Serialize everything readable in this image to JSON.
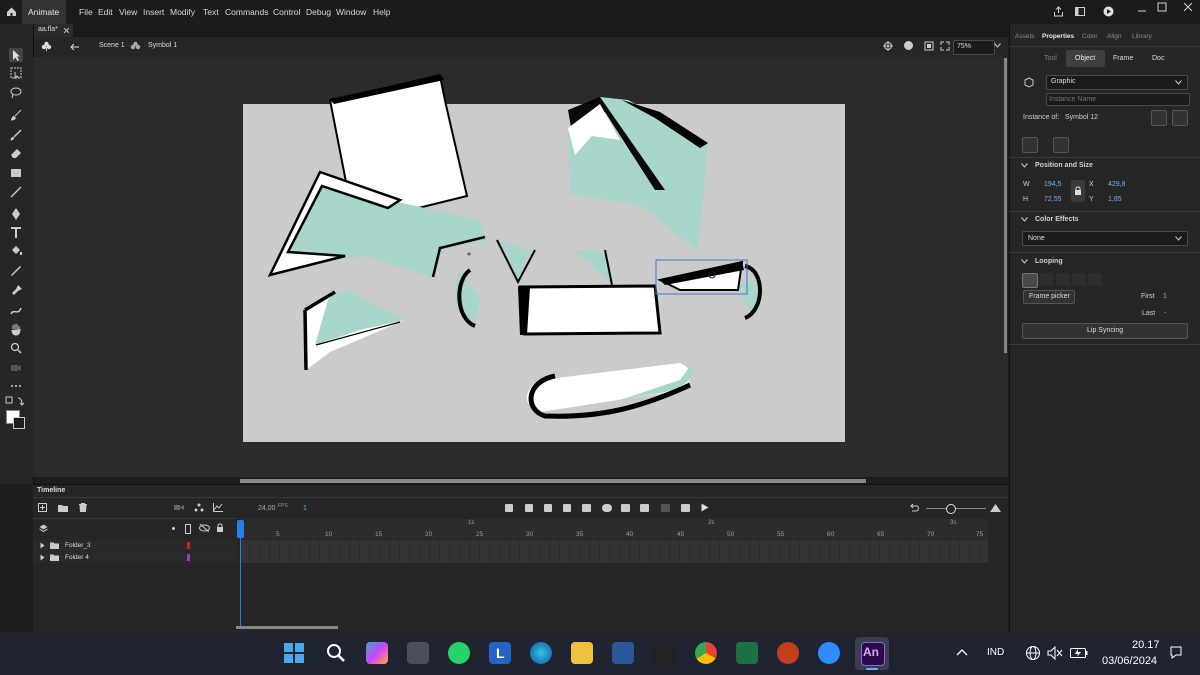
{
  "app": {
    "name": "Animate"
  },
  "menu": [
    "File",
    "Edit",
    "View",
    "Insert",
    "Modify",
    "Text",
    "Commands",
    "Control",
    "Debug",
    "Window",
    "Help"
  ],
  "doc": {
    "tab": "aa.fla*",
    "scene": "Scene 1",
    "symbol": "Symbol 1",
    "zoom": "75%"
  },
  "panel_tabs": {
    "assets": "Assets",
    "properties": "Properties",
    "color": "Color",
    "align": "Align",
    "library": "Library"
  },
  "sub_tabs": {
    "tool": "Tool",
    "object": "Object",
    "frame": "Frame",
    "doc": "Doc"
  },
  "object": {
    "type": "Graphic",
    "instance_placeholder": "Instance Name",
    "instance_of_label": "Instance of:",
    "instance_of": "Symbol 12"
  },
  "position_size": {
    "title": "Position and Size",
    "w_label": "W",
    "w": "194,5",
    "h_label": "H",
    "h": "72,55",
    "x_label": "X",
    "x": "429,8",
    "y_label": "Y",
    "y": "1,85"
  },
  "color_effects": {
    "title": "Color Effects",
    "value": "None"
  },
  "looping": {
    "title": "Looping",
    "frame_picker": "Frame picker",
    "first_label": "First",
    "first": "1",
    "last_label": "Last",
    "last": "-",
    "lip_sync": "Lip Syncing"
  },
  "timeline": {
    "title": "Timeline",
    "fps": "24,00",
    "fps_label": "FPS",
    "frame": "1",
    "seconds": [
      "1s",
      "2s",
      "3s"
    ],
    "frame_numbers": [
      "5",
      "10",
      "15",
      "20",
      "25",
      "30",
      "35",
      "40",
      "45",
      "50",
      "55",
      "60",
      "65",
      "70",
      "75"
    ],
    "layers": [
      {
        "name": "Folder_3",
        "color": "#cc2222"
      },
      {
        "name": "Folder 4",
        "color": "#9933cc"
      }
    ]
  },
  "taskbar": {
    "lang": "IND",
    "time": "20.17",
    "date": "03/06/2024"
  },
  "colors": {
    "accent": "#2680eb",
    "teal": "#a8d5cc",
    "stage": "#cbcbcb"
  }
}
